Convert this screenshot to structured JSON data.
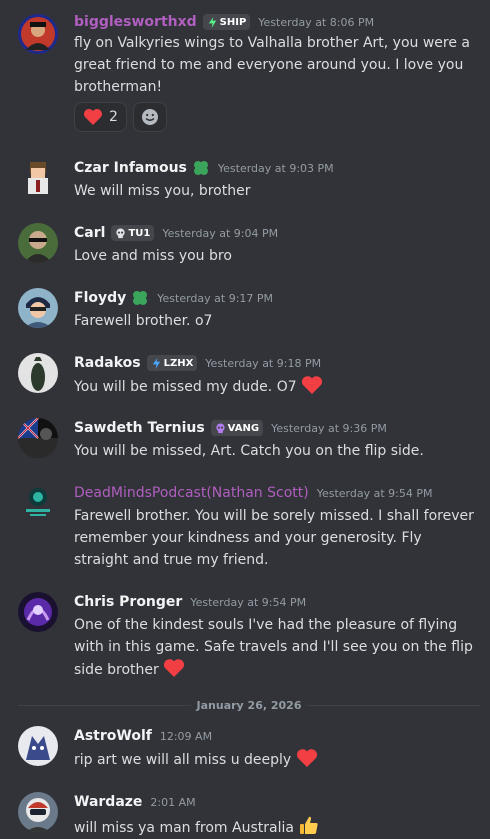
{
  "messages": [
    {
      "username": "bigglesworthxd",
      "tag": "SHIP",
      "timestamp": "Yesterday at 8:06 PM",
      "text": "fly on Valkyries wings to Valhalla brother Art, you were a great friend to me and everyone around you. I love you brotherman!",
      "reaction_count": "2",
      "avatar_icon": "nameplate-avatar"
    },
    {
      "username": "Czar Infamous",
      "timestamp": "Yesterday at 9:03 PM",
      "text": "We will miss you, brother",
      "avatar_icon": "pixel-character-avatar"
    },
    {
      "username": "Carl",
      "tag": "TU1",
      "timestamp": "Yesterday at 9:04 PM",
      "text": "Love and miss you bro",
      "avatar_icon": "photo-avatar"
    },
    {
      "username": "Floydy",
      "timestamp": "Yesterday at 9:17 PM",
      "text": "Farewell brother. o7",
      "avatar_icon": "cartoon-avatar"
    },
    {
      "username": "Radakos",
      "tag": "LZHX",
      "timestamp": "Yesterday at 9:18 PM",
      "text": "You will be missed my dude. O7",
      "avatar_icon": "figure-avatar"
    },
    {
      "username": "Sawdeth Ternius",
      "tag": "VANG",
      "timestamp": "Yesterday at 9:36 PM",
      "text": "You will be missed, Art. Catch you on the flip side.",
      "avatar_icon": "flag-avatar"
    },
    {
      "username": "DeadMindsPodcast(Nathan Scott)",
      "timestamp": "Yesterday at 9:54 PM",
      "text": "Farewell brother. You will be sorely missed. I shall forever remember your kindness and your generosity. Fly straight and true my friend.",
      "avatar_icon": "podcast-logo-avatar"
    },
    {
      "username": "Chris Pronger",
      "timestamp": "Yesterday at 9:54 PM",
      "text": "One of the kindest souls I've had the pleasure of flying with in this game. Safe travels and I'll see you on the flip side brother",
      "avatar_icon": "purple-art-avatar"
    },
    {
      "username": "AstroWolf",
      "timestamp": "12:09 AM",
      "text": "rip art we will all miss u deeply",
      "avatar_icon": "wolf-avatar"
    },
    {
      "username": "Wardaze",
      "timestamp": "2:01 AM",
      "text": "will miss ya man from Australia",
      "avatar_icon": "pilot-avatar"
    }
  ],
  "date_divider": "January 26, 2026",
  "colors": {
    "background": "#313338",
    "username": "#f2f3f5",
    "podcast_username": "#b05ebf",
    "timestamp": "#949ba4",
    "heart": "#f23f43",
    "clover": "#3ba55c",
    "tag_bg": "#45474d"
  }
}
